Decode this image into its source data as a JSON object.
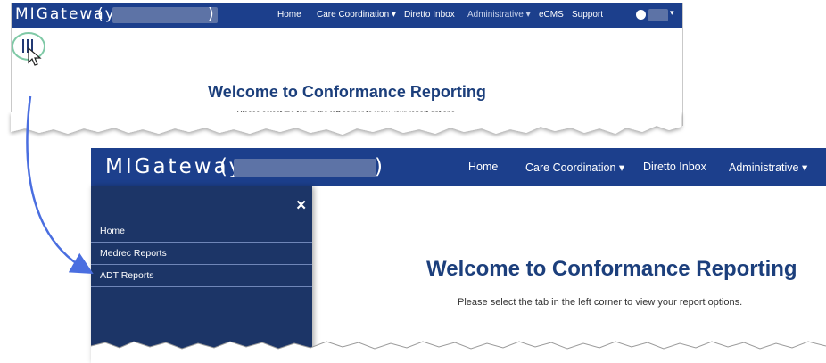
{
  "top_screenshot": {
    "brand": "MIGateway",
    "paren_open": "(",
    "paren_close": ")",
    "nav_items": [
      {
        "label": "Home"
      },
      {
        "label": "Care Coordination ▾"
      },
      {
        "label": "Diretto Inbox"
      },
      {
        "label": "Administrative ▾"
      },
      {
        "label": "eCMS"
      },
      {
        "label": "Support"
      }
    ],
    "user_caret": "▾",
    "hamburger_icon": "hamburger-icon",
    "welcome_title": "Welcome to Conformance Reporting",
    "welcome_subtitle": "Please select the tab in the left corner to view your report options."
  },
  "bottom_screenshot": {
    "brand": "MIGateway",
    "paren_open": "(",
    "paren_close": ")",
    "nav_items": [
      {
        "label": "Home"
      },
      {
        "label": "Care Coordination ▾"
      },
      {
        "label": "Diretto Inbox"
      },
      {
        "label": "Administrative ▾"
      }
    ],
    "sidebar": {
      "close_glyph": "✕",
      "items": [
        {
          "label": "Home"
        },
        {
          "label": "Medrec Reports"
        },
        {
          "label": "ADT Reports"
        }
      ]
    },
    "welcome_title": "Welcome to Conformance Reporting",
    "welcome_subtitle": "Please select the tab in the left corner to view your report options."
  },
  "colors": {
    "navbar": "#1c3f8c",
    "sidebar": "#1c3567",
    "title": "#1c3f7c",
    "arrow": "#4a6ee0",
    "highlight_ring": "#7fc9a6"
  }
}
